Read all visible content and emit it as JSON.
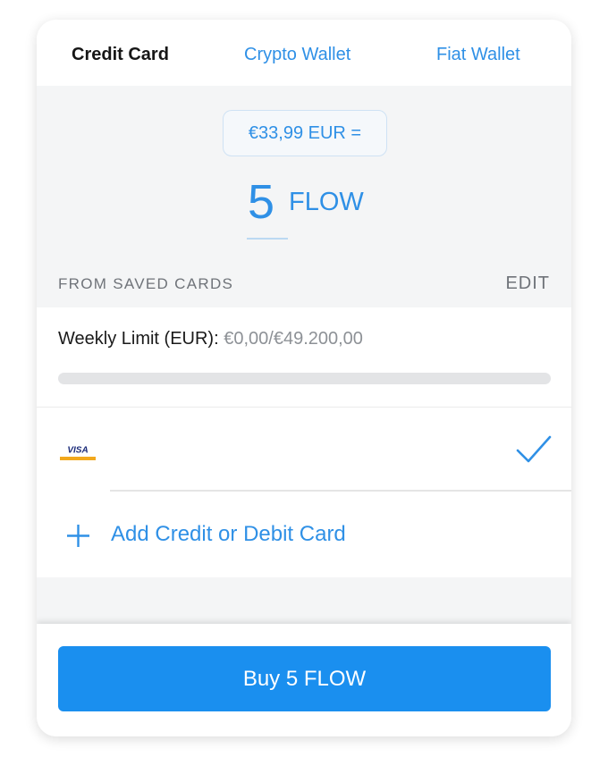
{
  "tabs": [
    {
      "label": "Credit Card",
      "active": true
    },
    {
      "label": "Crypto Wallet",
      "active": false
    },
    {
      "label": "Fiat Wallet",
      "active": false
    }
  ],
  "purchase": {
    "fiat_amount": "€33,99 EUR =",
    "token_amount": "5",
    "token_unit": "FLOW"
  },
  "saved_cards": {
    "section_label": "FROM SAVED CARDS",
    "edit_label": "EDIT",
    "weekly_limit_label": "Weekly Limit (EUR):",
    "weekly_limit_value": "€0,00/€49.200,00",
    "weekly_limit_progress": 0,
    "cards": [
      {
        "brand_icon": "visa-card-icon",
        "brand_text": "VISA",
        "selected": true
      }
    ],
    "add_card_label": "Add Credit or Debit Card"
  },
  "buy_button": {
    "label": "Buy 5 FLOW"
  },
  "colors": {
    "accent": "#2f90e6",
    "button": "#1a8fef",
    "background_grey": "#f4f5f6",
    "text_dark": "#161616",
    "text_muted": "#6f7379"
  }
}
